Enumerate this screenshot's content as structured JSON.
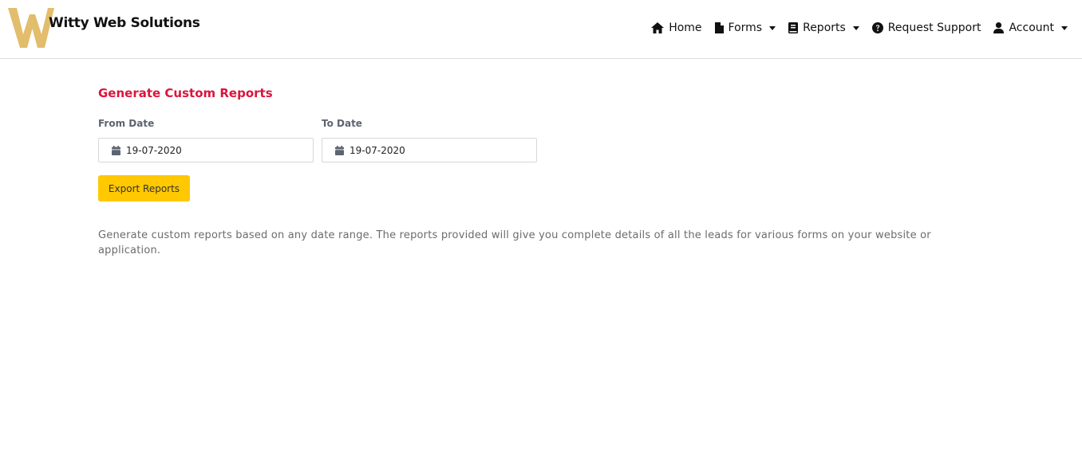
{
  "brand": {
    "name": "Witty Web Solutions",
    "logo_letter": "W",
    "logo_color": "#e2bd6b"
  },
  "nav": {
    "items": [
      {
        "label": "Home",
        "icon": "home-icon",
        "dropdown": false
      },
      {
        "label": "Forms",
        "icon": "file-icon",
        "dropdown": true
      },
      {
        "label": "Reports",
        "icon": "book-icon",
        "dropdown": true
      },
      {
        "label": "Request Support",
        "icon": "question-circle-icon",
        "dropdown": false
      },
      {
        "label": "Account",
        "icon": "user-icon",
        "dropdown": true
      }
    ]
  },
  "main": {
    "title": "Generate Custom Reports",
    "from_date": {
      "label": "From Date",
      "value": "19-07-2020",
      "icon": "calendar-icon"
    },
    "to_date": {
      "label": "To Date",
      "value": "19-07-2020",
      "icon": "calendar-icon"
    },
    "export_button": "Export Reports",
    "description": "Generate custom reports based on any date range. The reports provided will give you complete details of all the leads for various forms on your website or application."
  },
  "colors": {
    "title": "#dc143c",
    "button": "#ffc800",
    "logo": "#e2bd6b"
  }
}
